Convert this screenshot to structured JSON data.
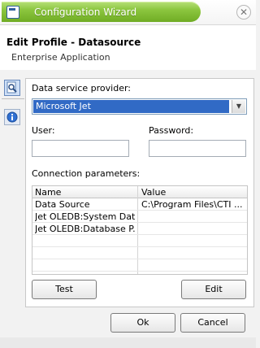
{
  "window": {
    "title": "Configuration Wizard",
    "close_glyph": "✕"
  },
  "header": {
    "title": "Edit Profile - Datasource",
    "subtitle": "Enterprise Application"
  },
  "form": {
    "provider_label": "Data service provider:",
    "provider_value": "Microsoft Jet",
    "user_label": "User:",
    "user_value": "",
    "password_label": "Password:",
    "password_value": "",
    "params_label": "Connection parameters:"
  },
  "grid": {
    "columns": [
      "Name",
      "Value"
    ],
    "rows": [
      {
        "name": "Data Source",
        "value": "C:\\Program Files\\CTI ..."
      },
      {
        "name": "Jet OLEDB:System Dat...",
        "value": ""
      },
      {
        "name": "Jet OLEDB:Database P...",
        "value": ""
      },
      {
        "name": "",
        "value": ""
      },
      {
        "name": "",
        "value": ""
      },
      {
        "name": "",
        "value": ""
      }
    ]
  },
  "buttons": {
    "test": "Test",
    "edit": "Edit",
    "ok": "Ok",
    "cancel": "Cancel"
  },
  "icons": {
    "tab1": "search-document-icon",
    "tab2": "info-icon"
  },
  "colors": {
    "title_green": "#8cc63f",
    "selection_blue": "#316ac5"
  }
}
